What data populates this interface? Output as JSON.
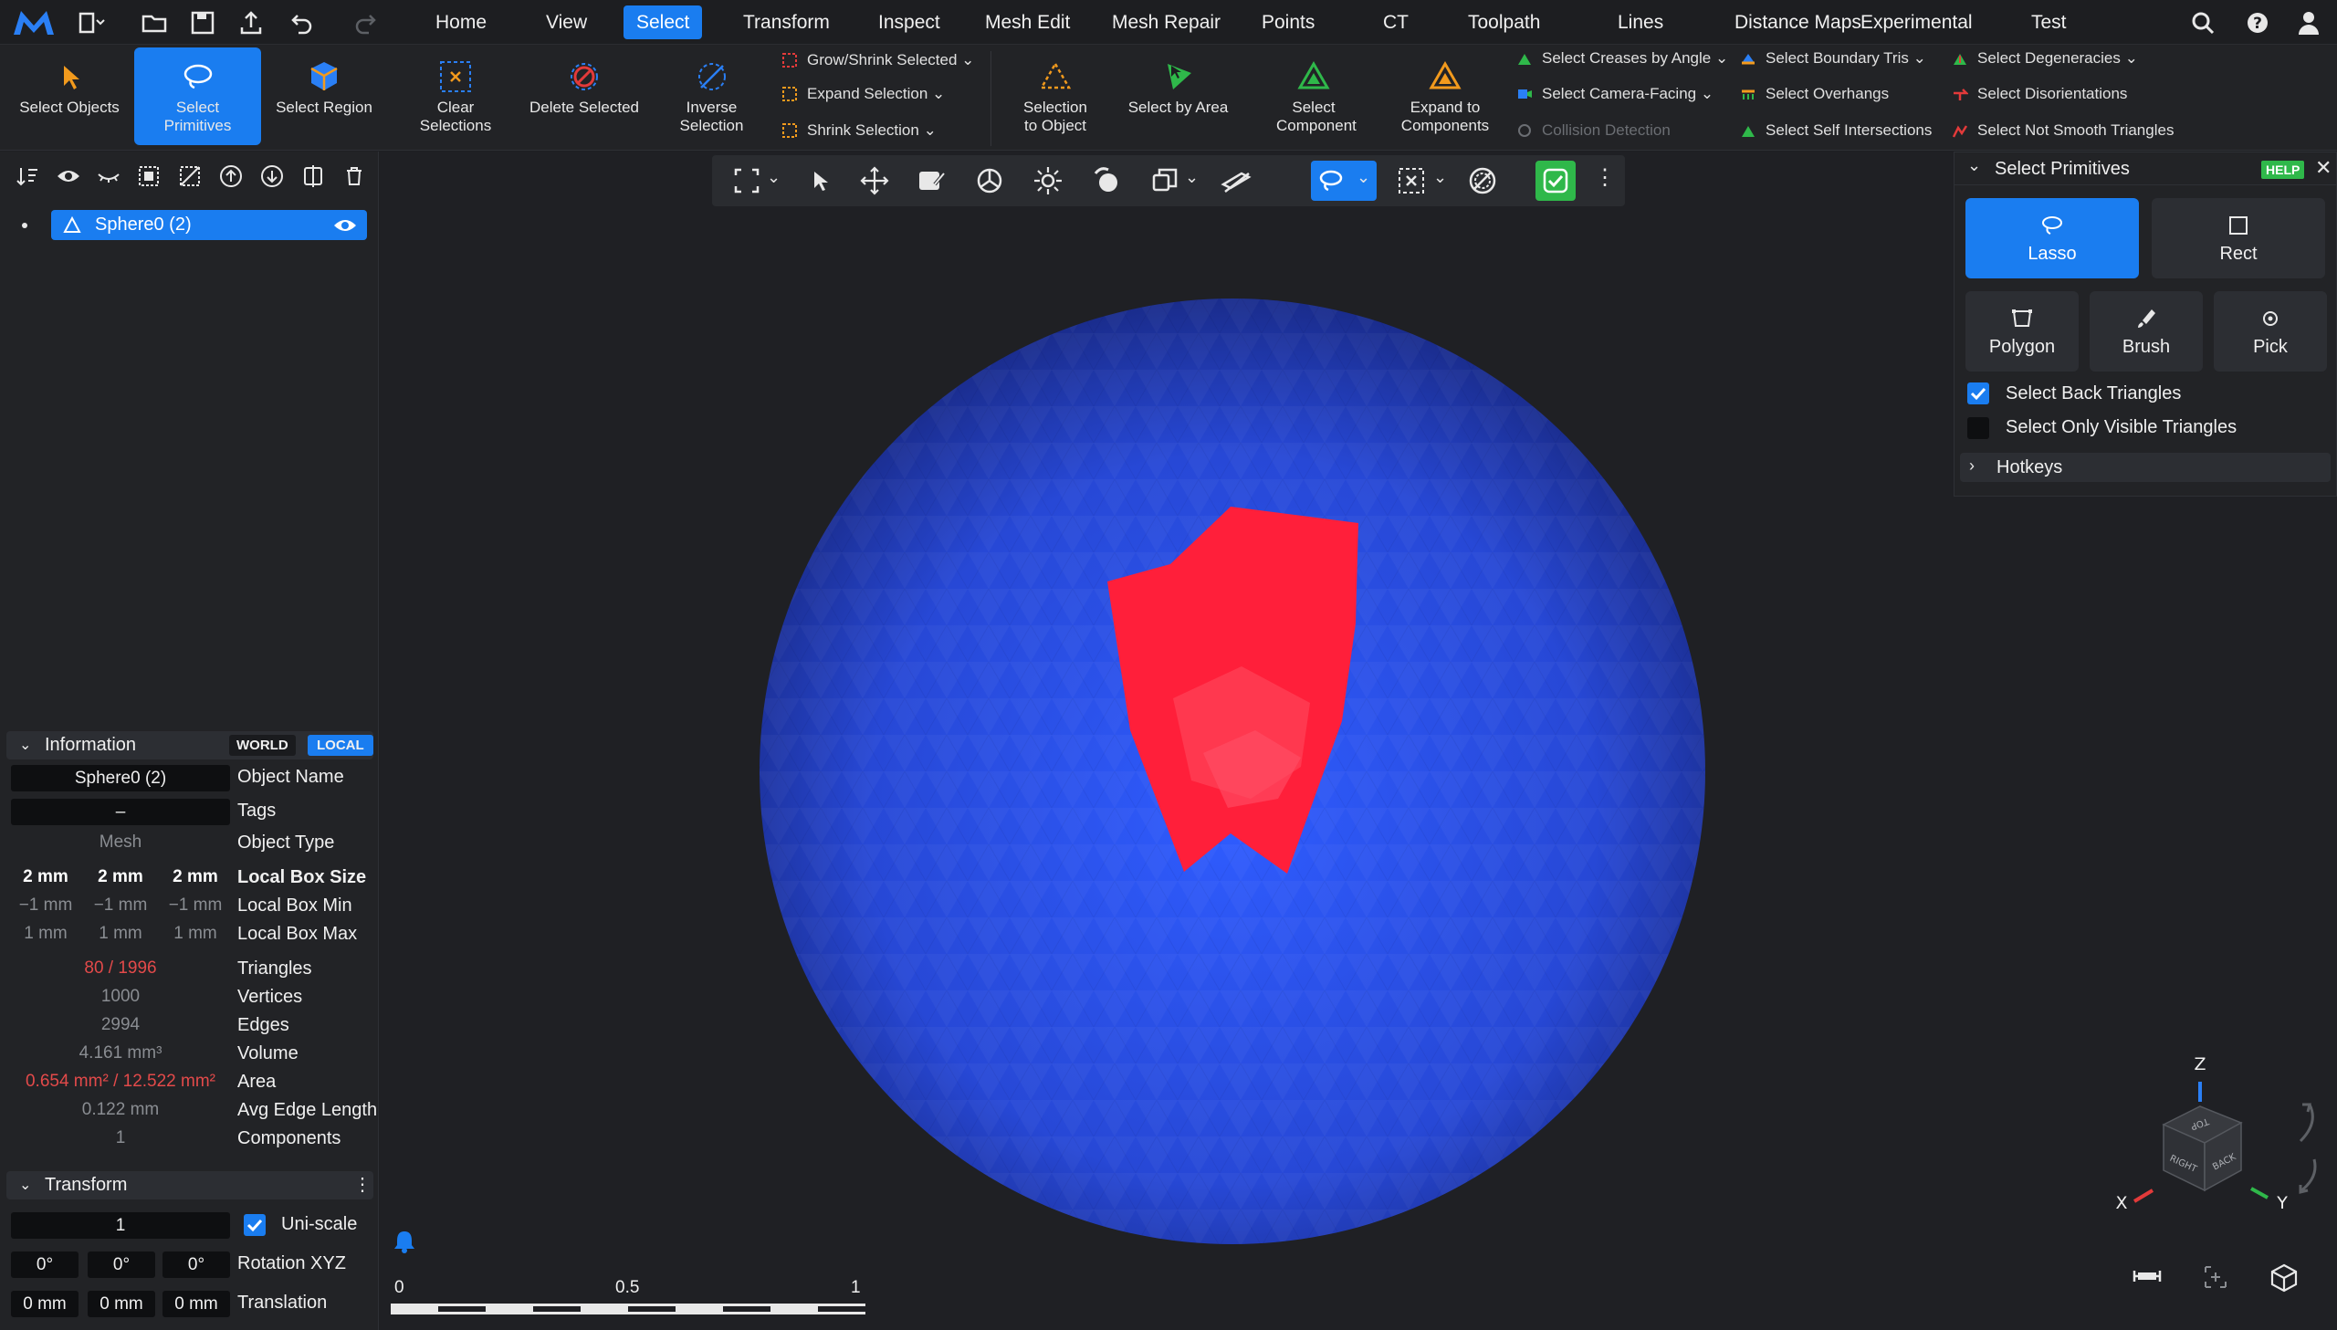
{
  "app": {
    "accent": "#1a7df0"
  },
  "menu": {
    "tabs": [
      "Home",
      "View",
      "Select",
      "Transform",
      "Inspect",
      "Mesh Edit",
      "Mesh Repair",
      "Points",
      "CT",
      "Toolpath",
      "Lines",
      "Distance Maps",
      "Experimental",
      "Test"
    ],
    "active": "Select"
  },
  "ribbon": {
    "select_objects": "Select Objects",
    "select_primitives": "Select Primitives",
    "select_region": "Select Region",
    "clear_selections": "Clear Selections",
    "delete_selected": "Delete Selected",
    "inverse_selection": "Inverse Selection",
    "grow_shrink": "Grow/Shrink Selected",
    "expand_selection": "Expand Selection",
    "shrink_selection": "Shrink Selection",
    "selection_to_object": "Selection to Object",
    "select_by_area": "Select by Area",
    "select_component": "Select Component",
    "expand_to_components": "Expand to Components",
    "select_creases": "Select Creases by Angle",
    "select_camera_facing": "Select Camera-Facing",
    "collision_detection": "Collision Detection",
    "select_boundary_tris": "Select Boundary Tris",
    "select_overhangs": "Select Overhangs",
    "select_self_intersections": "Select Self Intersections",
    "select_degeneracies": "Select Degeneracies",
    "select_disorientations": "Select Disorientations",
    "select_not_smooth": "Select Not Smooth Triangles"
  },
  "scene": {
    "object": "Sphere0 (2)"
  },
  "info": {
    "title": "Information",
    "world": "WORLD",
    "local": "LOCAL",
    "object_name_value": "Sphere0 (2)",
    "object_name_label": "Object Name",
    "tags_value": "–",
    "tags_label": "Tags",
    "type_value": "Mesh",
    "type_label": "Object Type",
    "box_size": [
      "2 mm",
      "2 mm",
      "2 mm"
    ],
    "box_size_label": "Local Box Size",
    "box_min": [
      "−1 mm",
      "−1 mm",
      "−1 mm"
    ],
    "box_min_label": "Local Box Min",
    "box_max": [
      "1 mm",
      "1 mm",
      "1 mm"
    ],
    "box_max_label": "Local Box Max",
    "triangles_value": "80 / 1996",
    "triangles_label": "Triangles",
    "vertices_value": "1000",
    "vertices_label": "Vertices",
    "edges_value": "2994",
    "edges_label": "Edges",
    "volume_value": "4.161 mm³",
    "volume_label": "Volume",
    "area_value": "0.654 mm² / 12.522 mm²",
    "area_label": "Area",
    "avg_edge_value": "0.122 mm",
    "avg_edge_label": "Avg Edge Length",
    "components_value": "1",
    "components_label": "Components"
  },
  "transform": {
    "title": "Transform",
    "scale_value": "1",
    "uniscale_label": "Uni-scale",
    "rotation": [
      "0°",
      "0°",
      "0°"
    ],
    "rotation_label": "Rotation XYZ",
    "translation": [
      "0 mm",
      "0 mm",
      "0 mm"
    ],
    "translation_label": "Translation"
  },
  "select_panel": {
    "title": "Select Primitives",
    "help": "HELP",
    "modes": {
      "lasso": "Lasso",
      "rect": "Rect",
      "polygon": "Polygon",
      "brush": "Brush",
      "pick": "Pick"
    },
    "back_triangles": "Select Back Triangles",
    "back_triangles_checked": true,
    "only_visible": "Select Only Visible Triangles",
    "only_visible_checked": false,
    "hotkeys": "Hotkeys"
  },
  "scale_bar": {
    "labels": [
      "0",
      "0.5",
      "1"
    ]
  },
  "gizmo": {
    "axes": [
      "Z",
      "X",
      "Y"
    ],
    "faces": [
      "TOP",
      "RIGHT",
      "BACK"
    ]
  },
  "colors": {
    "sphere": "#2f4fe0",
    "selection": "#ff1f3a"
  }
}
